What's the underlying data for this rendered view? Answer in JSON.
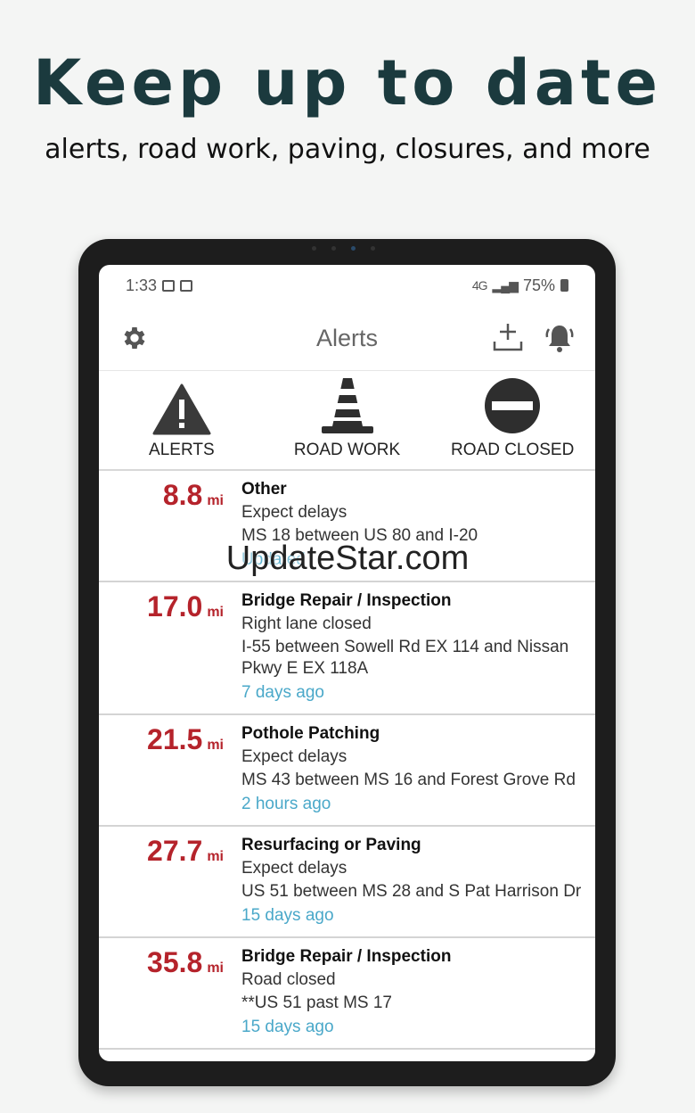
{
  "promo": {
    "headline": "Keep up to date",
    "subline": "alerts, road work, paving, closures, and more"
  },
  "status_bar": {
    "time": "1:33",
    "network": "4G",
    "battery": "75%"
  },
  "app_bar": {
    "title": "Alerts"
  },
  "filters": [
    {
      "label": "ALERTS",
      "icon": "warning-triangle-icon"
    },
    {
      "label": "ROAD WORK",
      "icon": "traffic-cone-icon"
    },
    {
      "label": "ROAD CLOSED",
      "icon": "no-entry-icon"
    }
  ],
  "alerts": [
    {
      "distance": "8.8",
      "unit": "mi",
      "type": "Other",
      "desc": "Expect delays",
      "location": "MS 18  between US 80 and I-20",
      "age": "Updated"
    },
    {
      "distance": "17.0",
      "unit": "mi",
      "type": "Bridge Repair / Inspection",
      "desc": "Right lane closed",
      "location": "I-55 between Sowell Rd EX 114 and Nissan Pkwy E EX 118A",
      "age": "7 days ago"
    },
    {
      "distance": "21.5",
      "unit": "mi",
      "type": "Pothole Patching",
      "desc": "Expect delays",
      "location": "MS 43 between MS 16 and Forest Grove Rd",
      "age": "2 hours ago"
    },
    {
      "distance": "27.7",
      "unit": "mi",
      "type": "Resurfacing or Paving",
      "desc": "Expect delays",
      "location": "US 51 between MS 28 and S Pat Harrison Dr",
      "age": "15 days ago"
    },
    {
      "distance": "35.8",
      "unit": "mi",
      "type": "Bridge Repair / Inspection",
      "desc": "Road closed",
      "location": "**US 51 past MS 17",
      "age": "15 days ago"
    }
  ],
  "watermark": "UpdateStar.com",
  "colors": {
    "distance": "#b5232b",
    "age": "#4aa8c9",
    "headline": "#1b3a3e"
  }
}
